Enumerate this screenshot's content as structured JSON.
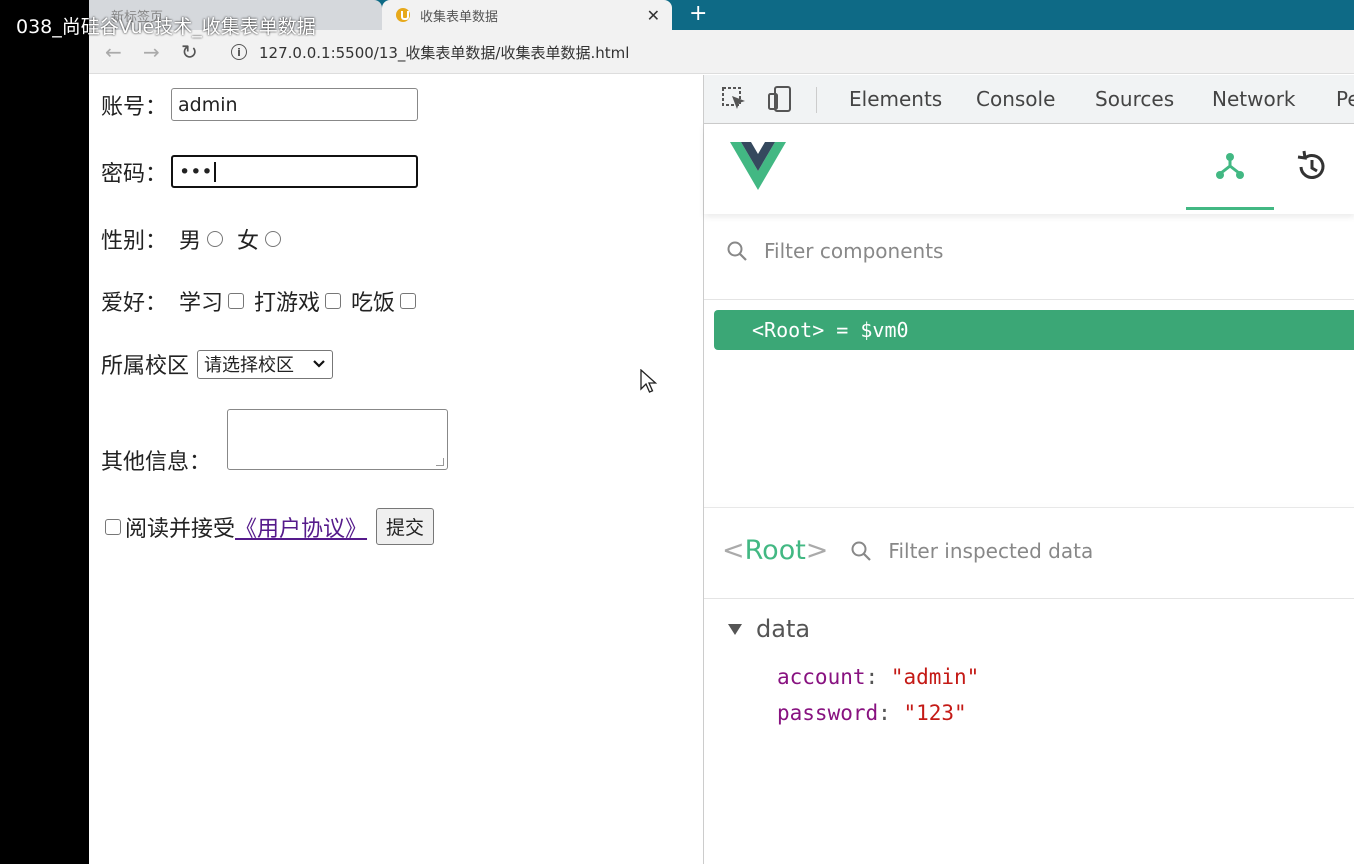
{
  "overlay": {
    "title": "038_尚硅谷Vue技术_收集表单数据"
  },
  "browser": {
    "tabs": [
      {
        "label": "新标签页"
      },
      {
        "label": "收集表单数据"
      }
    ],
    "new_tab": "+",
    "close": "✕",
    "url": "127.0.0.1:5500/13_收集表单数据/收集表单数据.html",
    "nav": {
      "back": "←",
      "forward": "→",
      "reload": "↻"
    }
  },
  "form": {
    "account_label": "账号：",
    "account_value": "admin",
    "password_label": "密码：",
    "password_value": "•••",
    "gender_label": "性别：",
    "gender_options": [
      "男",
      "女"
    ],
    "hobby_label": "爱好：",
    "hobby_options": [
      "学习",
      "打游戏",
      "吃饭"
    ],
    "campus_label": "所属校区",
    "campus_selected": "请选择校区",
    "other_label": "其他信息：",
    "agree_prefix": "阅读并接受",
    "agree_link": "《用户协议》",
    "submit_label": "提交"
  },
  "devtools": {
    "tabs": [
      "Elements",
      "Console",
      "Sources",
      "Network",
      "Pe"
    ],
    "filter_components_placeholder": "Filter components",
    "root_item": "<Root> = $vm0",
    "inspect": {
      "title_open": "<",
      "title_name": "Root",
      "title_close": ">",
      "filter_placeholder": "Filter inspected data",
      "section": "data",
      "props": [
        {
          "key": "account",
          "value": "\"admin\""
        },
        {
          "key": "password",
          "value": "\"123\""
        }
      ]
    },
    "accent": "#42b883"
  }
}
